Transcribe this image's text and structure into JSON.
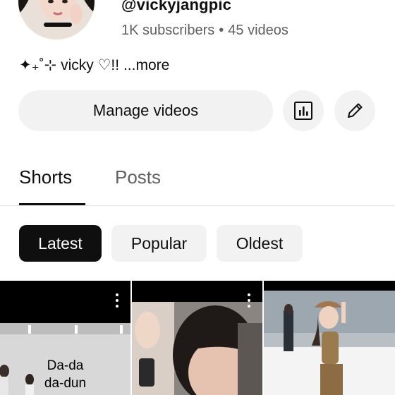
{
  "channel": {
    "handle": "@vickyjangpic",
    "subscribers": "1K subscribers",
    "separator": "•",
    "videos": "45 videos",
    "bio": "✦₊˚⊹ vicky ♡!!",
    "bio_more": "...more"
  },
  "actions": {
    "manage_videos": "Manage videos",
    "analytics_icon": "bar-chart-icon",
    "edit_icon": "pencil-icon"
  },
  "tabs": [
    {
      "label": "Shorts",
      "selected": true
    },
    {
      "label": "Posts",
      "selected": false
    }
  ],
  "filters": [
    {
      "label": "Latest",
      "selected": true
    },
    {
      "label": "Popular",
      "selected": false
    },
    {
      "label": "Oldest",
      "selected": false
    }
  ],
  "shorts": [
    {
      "overlay_text": "Da-da\nda-dun",
      "menu_icon": "more-vert-icon"
    },
    {
      "overlay_text": "",
      "menu_icon": "more-vert-icon"
    },
    {
      "overlay_text": "",
      "menu_icon": ""
    }
  ],
  "colors": {
    "text_primary": "#0f0f0f",
    "text_secondary": "#606060",
    "chip_bg": "#f2f2f2",
    "selected_chip_bg": "#0f0f0f"
  }
}
